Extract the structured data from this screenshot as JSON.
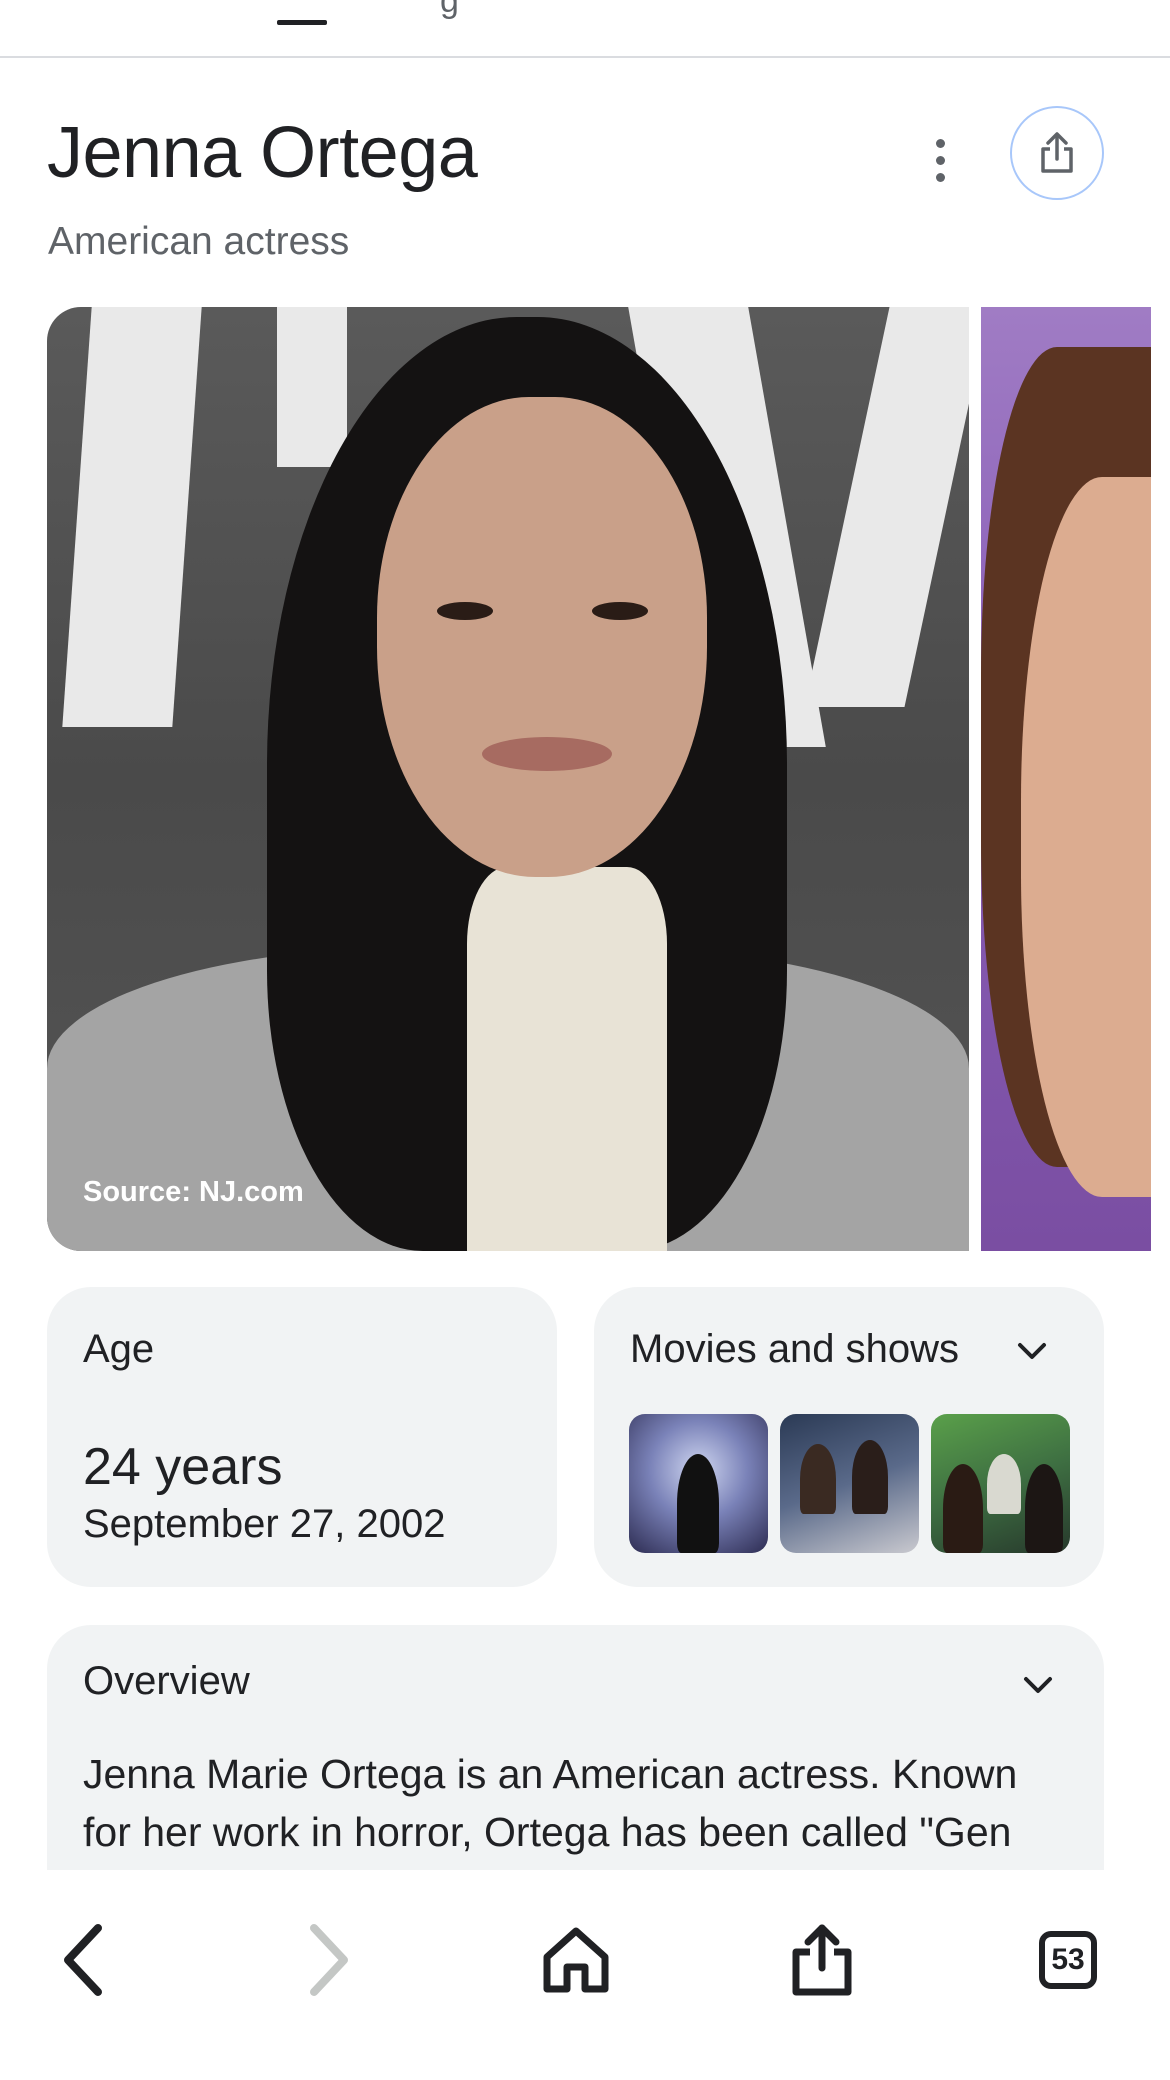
{
  "header": {
    "tab_partial_text": "g",
    "title": "Jenna Ortega",
    "subtitle": "American actress"
  },
  "images": {
    "main_source": "Source: NJ.com"
  },
  "age_card": {
    "label": "Age",
    "value": "24 years",
    "date": "September 27, 2002"
  },
  "movies_card": {
    "label": "Movies and shows",
    "thumbnails": [
      "movie-thumbnail-1",
      "movie-thumbnail-2",
      "movie-thumbnail-3"
    ]
  },
  "overview_card": {
    "label": "Overview",
    "text": "Jenna Marie Ortega is an American actress. Known for her work in horror, Ortega has been called \"Gen"
  },
  "bottom_nav": {
    "tabs_count": "53"
  },
  "colors": {
    "text_primary": "#202124",
    "text_secondary": "#5f6368",
    "card_bg": "#f1f3f4",
    "share_border": "#a8c7fa"
  }
}
